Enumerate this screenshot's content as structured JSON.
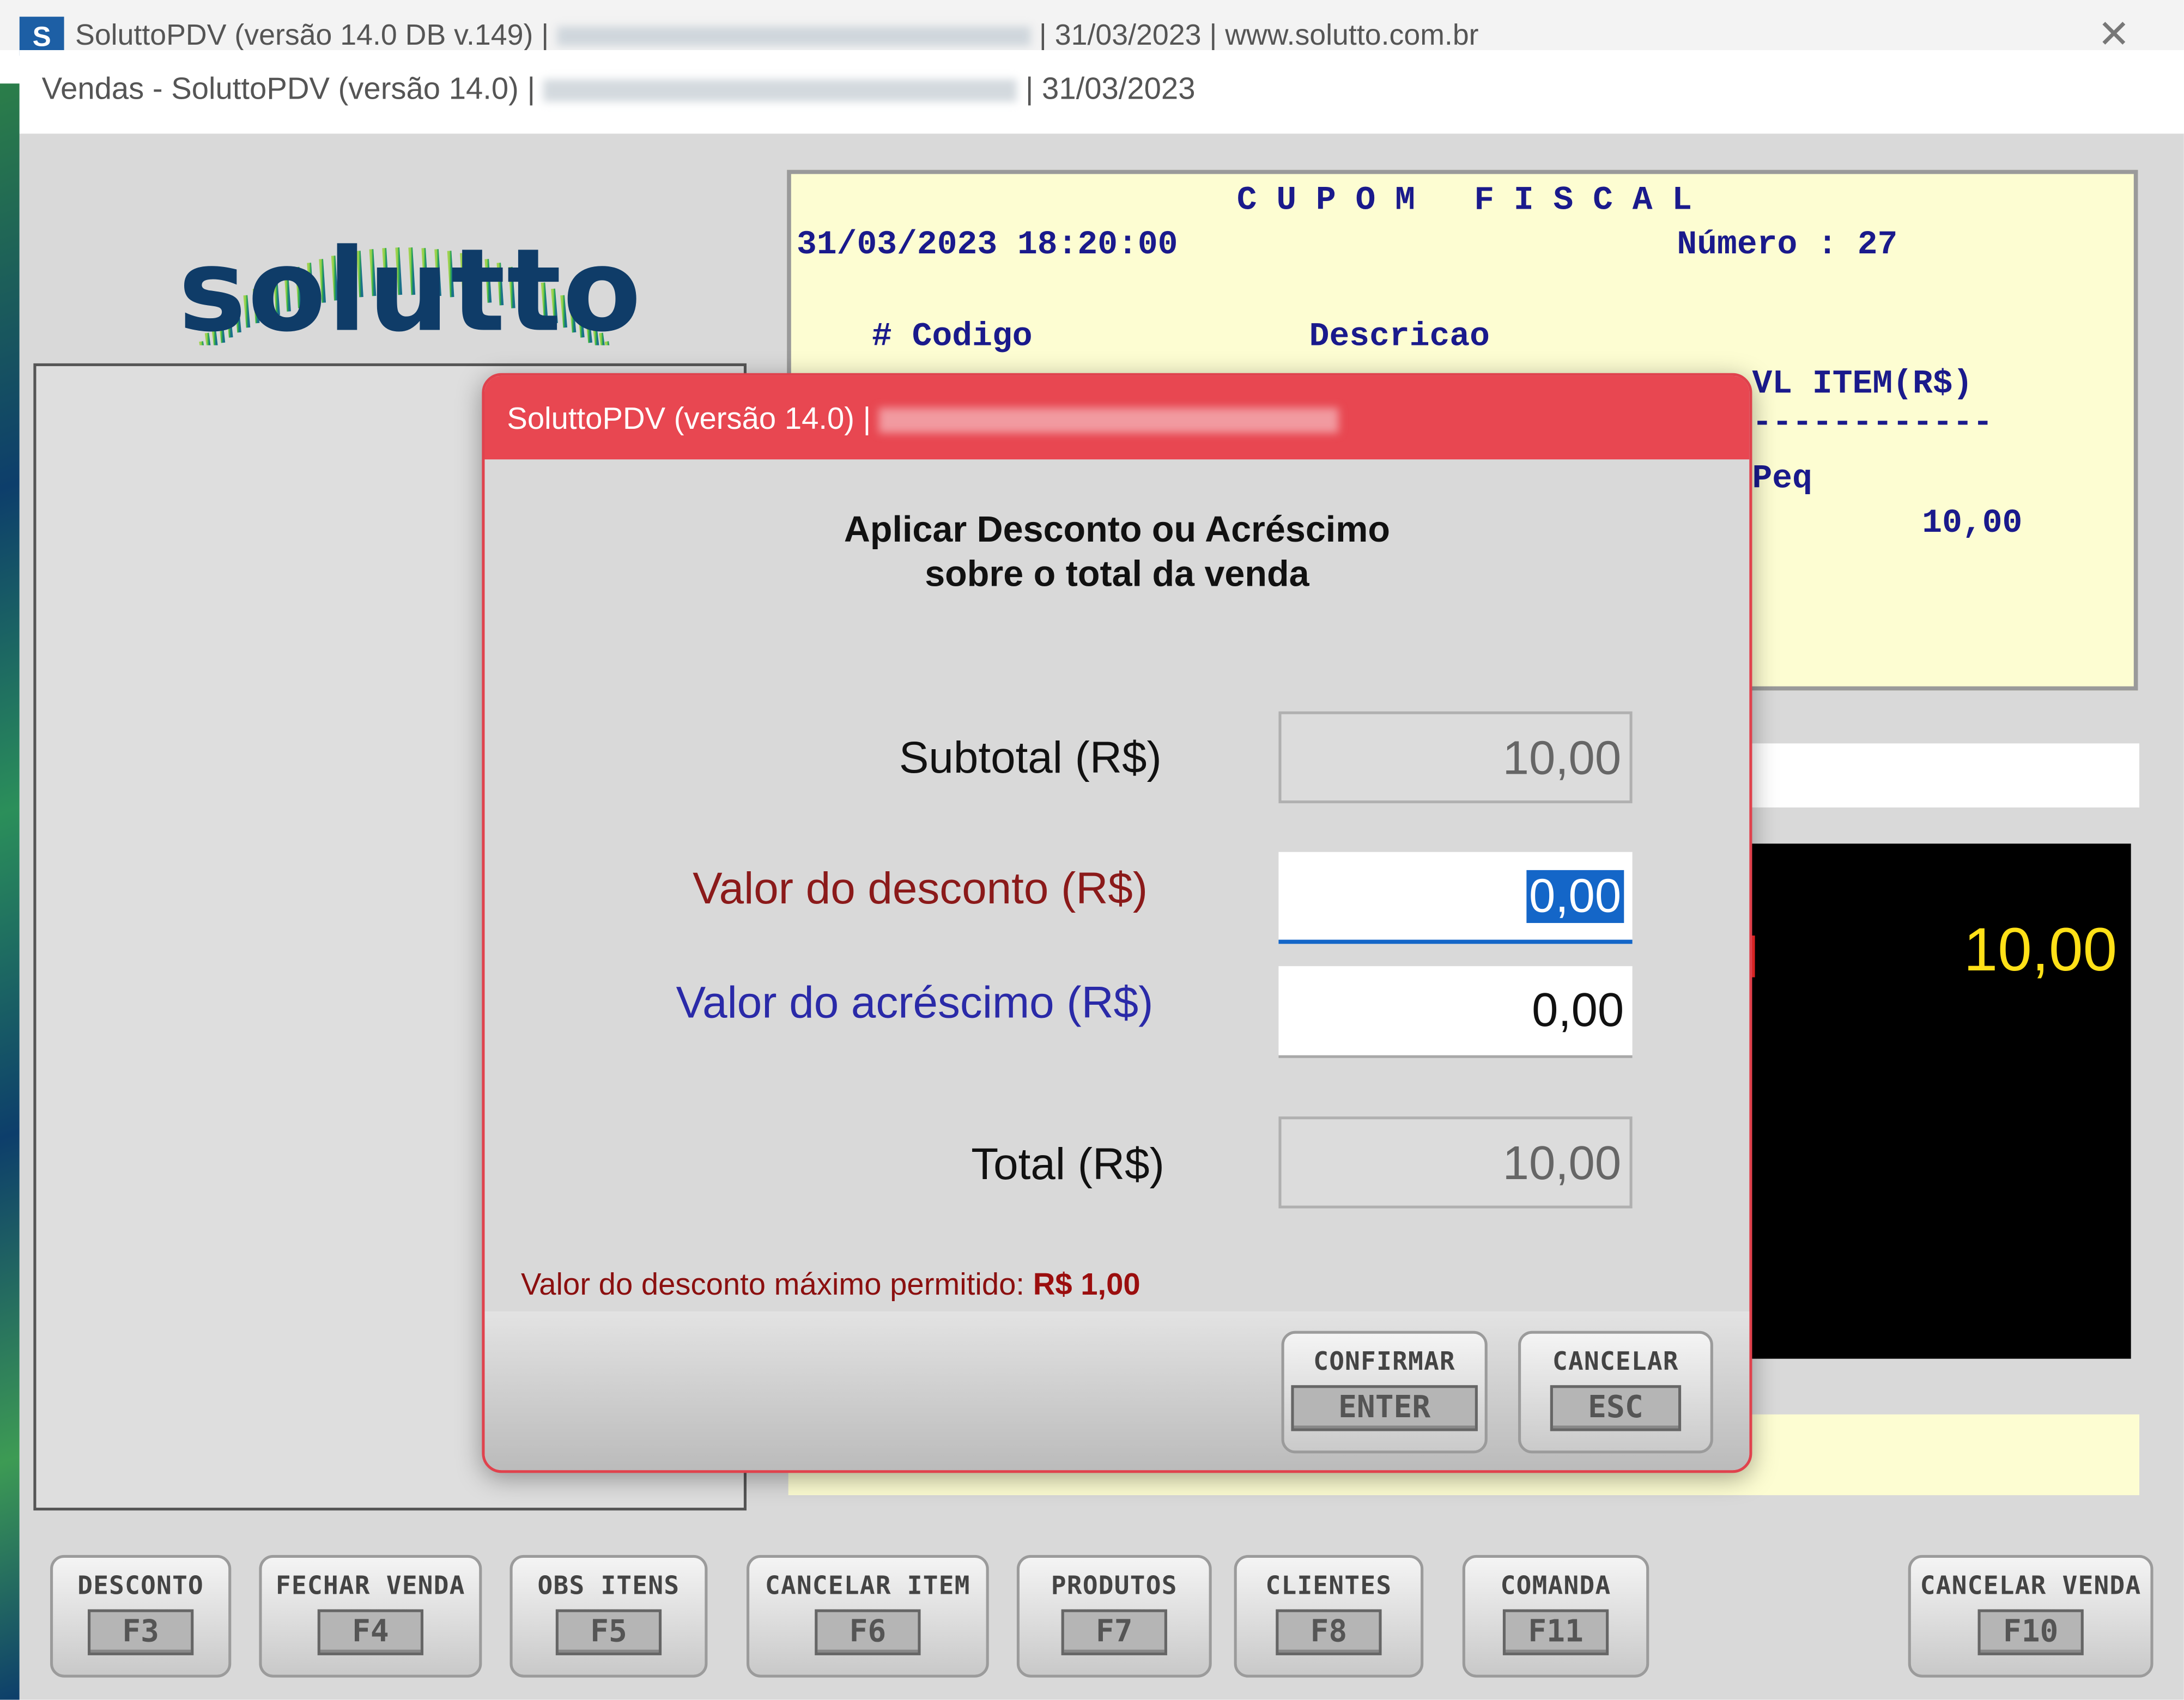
{
  "outer_window": {
    "logo_letter": "S",
    "title_prefix": "SoluttoPDV (versão 14.0 DB v.149) |",
    "title_suffix": "| 31/03/2023 | www.solutto.com.br",
    "close_glyph": "✕"
  },
  "inner_window": {
    "title_prefix": "Vendas - SoluttoPDV (versão 14.0) |",
    "title_suffix": "| 31/03/2023"
  },
  "brand": {
    "name": "solutto",
    "colors": {
      "navy": "#0f3c68",
      "green": "#2fae4a"
    }
  },
  "receipt": {
    "title": "CUPOM FISCAL",
    "datetime": "31/03/2023 18:20:00",
    "numero": "Número : 27",
    "col_num": "#  Codigo",
    "col_desc": "Descricao",
    "col_vl_item": "VL ITEM(R$)",
    "separator": "------------",
    "item_desc_tail": "Peq",
    "item_value": "10,00"
  },
  "display": {
    "total": "10,00"
  },
  "dialog": {
    "title": "SoluttoPDV (versão 14.0) |",
    "heading_line1": "Aplicar Desconto ou Acréscimo",
    "heading_line2": "sobre o total da venda",
    "subtotal_label": "Subtotal (R$)",
    "subtotal_value": "10,00",
    "desconto_label": "Valor do desconto (R$)",
    "desconto_value": "0,00",
    "acrescimo_label": "Valor do acréscimo (R$)",
    "acrescimo_value": "0,00",
    "total_label": "Total (R$)",
    "total_value": "10,00",
    "max_note_label": "Valor do desconto máximo permitido:",
    "max_note_value": "R$ 1,00",
    "confirm_label": "CONFIRMAR",
    "confirm_key": "ENTER",
    "cancel_label": "CANCELAR",
    "cancel_key": "ESC",
    "colors": {
      "header": "#e84751",
      "desconto": "#8b1a1a",
      "acrescimo": "#2a2aa8"
    }
  },
  "fkeys": [
    {
      "label": "DESCONTO",
      "key": "F3"
    },
    {
      "label": "FECHAR VENDA",
      "key": "F4"
    },
    {
      "label": "OBS ITENS",
      "key": "F5"
    },
    {
      "label": "CANCELAR ITEM",
      "key": "F6"
    },
    {
      "label": "PRODUTOS",
      "key": "F7"
    },
    {
      "label": "CLIENTES",
      "key": "F8"
    },
    {
      "label": "COMANDA",
      "key": "F11"
    },
    {
      "label": "CANCELAR VENDA",
      "key": "F10"
    }
  ]
}
